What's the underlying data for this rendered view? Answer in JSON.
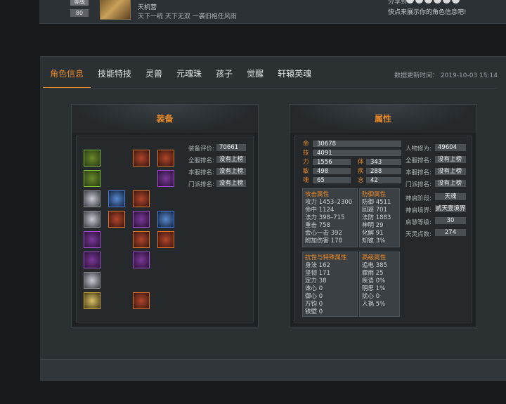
{
  "header": {
    "level_label": "等级",
    "level_value": "80",
    "sect": "天机营",
    "motto": "天下一统 天下无双 一袭旧袍任风雨",
    "share_label": "分享到",
    "share_hint": "快点来展示你的角色信息吧!"
  },
  "tabs": [
    {
      "label": "角色信息",
      "active": true
    },
    {
      "label": "技能特技"
    },
    {
      "label": "灵兽"
    },
    {
      "label": "元魂珠"
    },
    {
      "label": "孩子"
    },
    {
      "label": "觉醒"
    },
    {
      "label": "轩辕英魂"
    }
  ],
  "update_time": "数据更新时间：  2019-10-03 15:14",
  "equipment": {
    "title": "装备",
    "score_label": "装备评价:",
    "score_value": "70661",
    "server_rank_label": "全服排名:",
    "server_rank_value": "没有上榜",
    "local_rank_label": "本服排名:",
    "local_rank_value": "没有上榜",
    "sect_rank_label": "门派排名:",
    "sect_rank_value": "没有上榜"
  },
  "attributes": {
    "title": "属性",
    "life_label": "命",
    "life_value": "30678",
    "skill_label": "技",
    "skill_value": "4091",
    "str_label": "力",
    "str_value": "1556",
    "con_label": "体",
    "con_value": "343",
    "agi_label": "敏",
    "agi_value": "498",
    "fre_label": "疾",
    "fre_value": "288",
    "soul_label": "魂",
    "soul_value": "65",
    "mind_label": "念",
    "mind_value": "42",
    "attack": {
      "title": "攻击属性",
      "lines": [
        "攻力 1453–2300",
        "命中 1124",
        "法力 398–715",
        "重击 758",
        "会心一击 392",
        "附加伤害 178"
      ]
    },
    "defense": {
      "title": "防御属性",
      "lines": [
        "防御 4511",
        "回避 701",
        "法防 1883",
        "神明 29",
        "化解 91",
        "知彼 3%"
      ]
    },
    "resist": {
      "title": "抗性与特殊属性",
      "lines": [
        "身法 162",
        "坚韧 171",
        "定力 38",
        "诛心 0",
        "御心 0",
        "万钧 0",
        "铁壁 0"
      ]
    },
    "advanced": {
      "title": "高级属性",
      "lines": [
        "追电 385",
        "骤雨 25",
        "疾语 0%",
        "明思 1%",
        "扰心 0",
        "人祸 5%"
      ]
    },
    "cultivation_label": "人物修为:",
    "cultivation_value": "49604",
    "server_rank_label": "全服排名:",
    "server_rank_value": "没有上榜",
    "local_rank_label": "本服排名:",
    "local_rank_value": "没有上榜",
    "sect_rank_label": "门派排名:",
    "sect_rank_value": "没有上榜",
    "divine_stage_label": "神启阶段:",
    "divine_stage_value": "天魂",
    "divine_realm_label": "神启境界:",
    "divine_realm_value": "贰天壹境界",
    "wisdom_label": "启慧等级:",
    "wisdom_value": "30",
    "spirit_label": "天灵点数:",
    "spirit_value": "274"
  }
}
